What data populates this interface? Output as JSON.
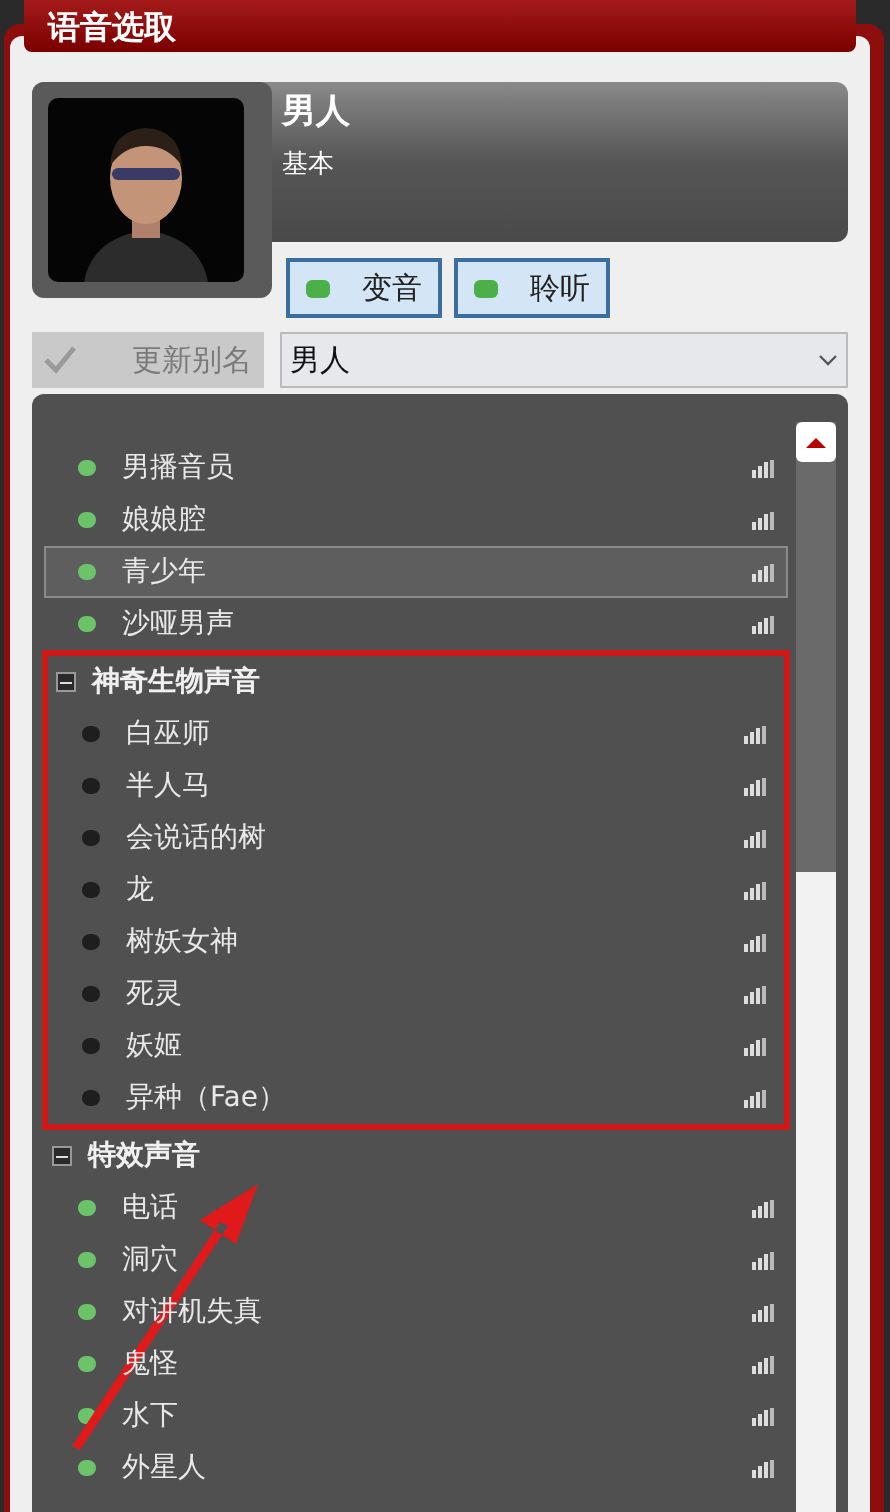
{
  "window": {
    "title": "语音选取"
  },
  "voice": {
    "name": "男人",
    "category": "基本"
  },
  "toggles": [
    {
      "label": "变音",
      "on": true
    },
    {
      "label": "聆听",
      "on": true
    }
  ],
  "rename_button": {
    "label": "更新别名",
    "disabled": true
  },
  "alias_field": {
    "value": "男人"
  },
  "groups": [
    {
      "expanded": true,
      "highlighted": false,
      "children": [
        {
          "label": "男播音员",
          "selected": false,
          "color": "#6cc46a"
        },
        {
          "label": "娘娘腔",
          "selected": false,
          "color": "#6cc46a"
        },
        {
          "label": "青少年",
          "selected": true,
          "color": "#6cc46a"
        },
        {
          "label": "沙哑男声",
          "selected": false,
          "color": "#6cc46a"
        }
      ]
    },
    {
      "label": "神奇生物声音",
      "expanded": true,
      "highlighted": true,
      "children": [
        {
          "label": "白巫师",
          "selected": false,
          "color": "#1e1e1e"
        },
        {
          "label": "半人马",
          "selected": false,
          "color": "#1e1e1e"
        },
        {
          "label": "会说话的树",
          "selected": false,
          "color": "#1e1e1e"
        },
        {
          "label": "龙",
          "selected": false,
          "color": "#1e1e1e"
        },
        {
          "label": "树妖女神",
          "selected": false,
          "color": "#1e1e1e"
        },
        {
          "label": "死灵",
          "selected": false,
          "color": "#1e1e1e"
        },
        {
          "label": "妖姬",
          "selected": false,
          "color": "#1e1e1e"
        },
        {
          "label": "异种（Fae）",
          "selected": false,
          "color": "#1e1e1e"
        }
      ]
    },
    {
      "label": "特效声音",
      "expanded": true,
      "highlighted": false,
      "children": [
        {
          "label": "电话",
          "selected": false,
          "color": "#6cc46a"
        },
        {
          "label": "洞穴",
          "selected": false,
          "color": "#6cc46a"
        },
        {
          "label": "对讲机失真",
          "selected": false,
          "color": "#6cc46a"
        },
        {
          "label": "鬼怪",
          "selected": false,
          "color": "#6cc46a"
        },
        {
          "label": "水下",
          "selected": false,
          "color": "#6cc46a"
        },
        {
          "label": "外星人",
          "selected": false,
          "color": "#6cc46a"
        }
      ]
    }
  ],
  "annotation_arrow": true
}
